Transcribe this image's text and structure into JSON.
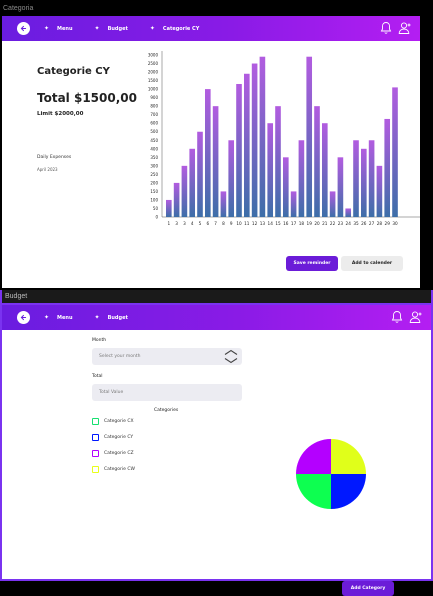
{
  "frame1": {
    "window_label": "Categoria",
    "nav": {
      "items": [
        "Menu",
        "Budget",
        "Categorie CY"
      ]
    },
    "title": "Categorie CY",
    "total_label": "Total",
    "total_value": "$1500,00",
    "limit": "Limit $2000,00",
    "daily_label": "Daily Expenses",
    "daily_date": "April 2023",
    "save_reminder": "Save reminder",
    "add_to_calendar": "Add to calender"
  },
  "frame2": {
    "window_label": "Budget",
    "nav": {
      "items": [
        "Menu",
        "Budget"
      ]
    },
    "month_label": "Month",
    "month_placeholder": "Select your month",
    "total_label": "Total",
    "total_placeholder": "Total Value",
    "categories_heading": "Categories",
    "categories": [
      {
        "name": "Categorie CX",
        "color": "#b400ff"
      },
      {
        "name": "Categorie CY",
        "color": "#0018ff"
      },
      {
        "name": "Categorie CZ",
        "color": "#b400ff"
      },
      {
        "name": "Categorie CW",
        "color": "#e8ff1a"
      }
    ],
    "add_category": "Add Category"
  },
  "colors": {
    "accent": "#6b1cd8",
    "nav_gradient_start": "#6a1de0",
    "nav_gradient_end": "#b41ef2",
    "bar_top": "#b25ce0",
    "bar_bottom": "#3d6ea8"
  },
  "chart_data": [
    {
      "type": "bar",
      "categories": [
        "1",
        "2",
        "3",
        "4",
        "5",
        "6",
        "7",
        "8",
        "9",
        "10",
        "11",
        "12",
        "13",
        "14",
        "15",
        "16",
        "17",
        "18",
        "19",
        "20",
        "21",
        "22",
        "23",
        "24",
        "25",
        "26",
        "27",
        "28",
        "29",
        "30"
      ],
      "values": [
        100,
        200,
        300,
        400,
        500,
        1000,
        800,
        150,
        450,
        1300,
        1900,
        2500,
        2900,
        600,
        800,
        350,
        150,
        450,
        2900,
        800,
        600,
        150,
        350,
        50,
        450,
        400,
        450,
        300,
        650,
        1100
      ],
      "tick_labels_x": [
        "1",
        "3",
        "3",
        "4",
        "5",
        "6",
        "7",
        "8",
        "9",
        "10",
        "11",
        "12",
        "13",
        "14",
        "15",
        "16",
        "17",
        "18",
        "19",
        "20",
        "21",
        "22",
        "23",
        "24",
        "35",
        "26",
        "27",
        "28",
        "29",
        "30"
      ],
      "y_ticks": [
        0,
        50,
        100,
        150,
        200,
        250,
        300,
        350,
        400,
        450,
        500,
        600,
        700,
        800,
        900,
        1000,
        1500,
        2000,
        2500,
        3000
      ],
      "title": "",
      "xlabel": "",
      "ylabel": "",
      "ylim": [
        0,
        3000
      ]
    },
    {
      "type": "pie",
      "slices": [
        {
          "value": 25,
          "color": "#b400ff"
        },
        {
          "value": 25,
          "color": "#e0ff1a"
        },
        {
          "value": 25,
          "color": "#0018ff"
        },
        {
          "value": 25,
          "color": "#0dff50"
        }
      ]
    }
  ]
}
